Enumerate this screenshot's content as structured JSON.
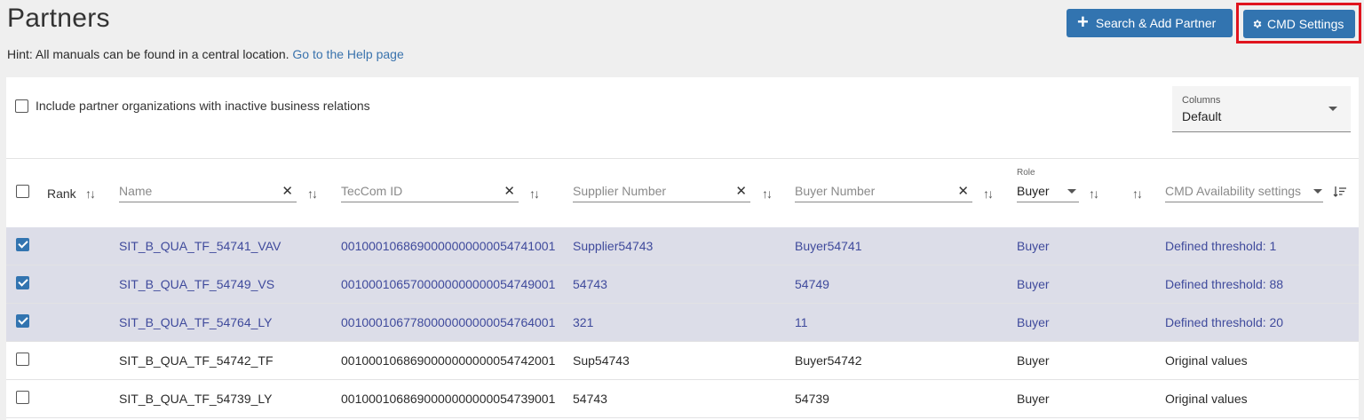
{
  "page": {
    "title": "Partners",
    "hint_text": "Hint: All manuals can be found in a central location.",
    "hint_link": "Go to the Help page"
  },
  "toolbar": {
    "add_partner_label": "Search & Add Partner",
    "cmd_settings_label": "CMD Settings",
    "highlight_color": "#e0141e",
    "button_color": "#3274b0"
  },
  "filters": {
    "inactive_label": "Include partner organizations with inactive business relations",
    "inactive_checked": false,
    "columns_label": "Columns",
    "columns_value": "Default"
  },
  "table": {
    "headers": {
      "rank": "Rank",
      "name": "Name",
      "tecc_id": "TecCom ID",
      "supplier_number": "Supplier Number",
      "buyer_number": "Buyer Number",
      "role_label": "Role",
      "role_value": "Buyer",
      "cmd_availability": "CMD Availability settings"
    },
    "rows": [
      {
        "selected": true,
        "name": "SIT_B_QUA_TF_54741_VAV",
        "tecc_id": "0010001068690000000000054741001",
        "supplier_number": "Supplier54743",
        "buyer_number": "Buyer54741",
        "role": "Buyer",
        "cmd": "Defined threshold: 1"
      },
      {
        "selected": true,
        "name": "SIT_B_QUA_TF_54749_VS",
        "tecc_id": "0010001065700000000000054749001",
        "supplier_number": "54743",
        "buyer_number": "54749",
        "role": "Buyer",
        "cmd": "Defined threshold: 88"
      },
      {
        "selected": true,
        "name": "SIT_B_QUA_TF_54764_LY",
        "tecc_id": "0010001067780000000000054764001",
        "supplier_number": "321",
        "buyer_number": "11",
        "role": "Buyer",
        "cmd": "Defined threshold: 20"
      },
      {
        "selected": false,
        "name": "SIT_B_QUA_TF_54742_TF",
        "tecc_id": "0010001068690000000000054742001",
        "supplier_number": "Sup54743",
        "buyer_number": "Buyer54742",
        "role": "Buyer",
        "cmd": "Original values"
      },
      {
        "selected": false,
        "name": "SIT_B_QUA_TF_54739_LY",
        "tecc_id": "0010001068690000000000054739001",
        "supplier_number": "54743",
        "buyer_number": "54739",
        "role": "Buyer",
        "cmd": "Original values"
      }
    ]
  }
}
